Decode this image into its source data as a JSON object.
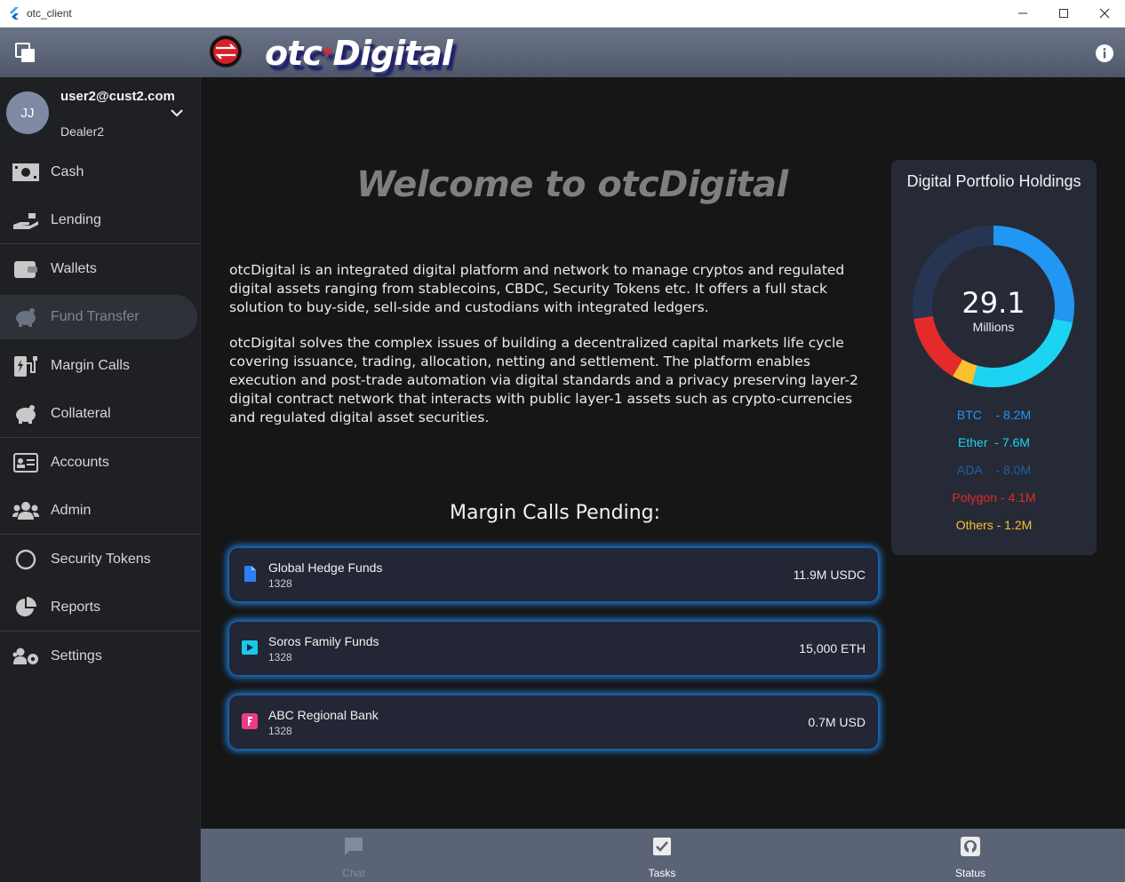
{
  "window": {
    "title": "otc_client"
  },
  "appbar": {
    "brand_left": "otc",
    "brand_star": "*",
    "brand_right": "Digital"
  },
  "user": {
    "initials": "JJ",
    "email": "user2@cust2.com",
    "role": "Dealer2"
  },
  "sidebar": {
    "items": [
      {
        "label": "Cash",
        "icon": "cash-icon"
      },
      {
        "label": "Lending",
        "icon": "hand-coin-icon"
      },
      {
        "label": "Wallets",
        "icon": "wallet-icon"
      },
      {
        "label": "Fund Transfer",
        "icon": "piggy-bank-icon",
        "active": true
      },
      {
        "label": "Margin Calls",
        "icon": "charging-station-icon"
      },
      {
        "label": "Collateral",
        "icon": "piggy-bank-icon"
      },
      {
        "label": "Accounts",
        "icon": "id-card-icon"
      },
      {
        "label": "Admin",
        "icon": "users-icon"
      },
      {
        "label": "Security Tokens",
        "icon": "circle-icon"
      },
      {
        "label": "Reports",
        "icon": "pie-chart-icon"
      },
      {
        "label": "Settings",
        "icon": "users-cog-icon"
      }
    ]
  },
  "main": {
    "welcome": "Welcome to otcDigital",
    "para1": "otcDigital is an integrated digital platform and network to manage cryptos and regulated digital assets ranging from stablecoins, CBDC, Security Tokens etc. It offers a full stack solution to buy-side, sell-side and custodians with integrated ledgers.",
    "para2": "otcDigital solves the complex issues of building a decentralized capital markets life cycle covering issuance, trading, allocation, netting and settlement. The platform enables execution and post-trade automation via digital standards and a privacy preserving layer-2 digital contract network that interacts with public layer-1 assets such as crypto-currencies and regulated digital asset securities.",
    "margin_title": "Margin Calls Pending:",
    "margin_calls": [
      {
        "name": "Global Hedge Funds",
        "id": "1328",
        "amount": "11.9M USDC",
        "icon": "document-icon",
        "icon_color": "#2f7ff0"
      },
      {
        "name": "Soros Family Funds",
        "id": "1328",
        "amount": "15,000 ETH",
        "icon": "play-icon",
        "icon_color": "#19c8e8"
      },
      {
        "name": "ABC Regional Bank",
        "id": "1328",
        "amount": "0.7M USD",
        "icon": "flash-doc-icon",
        "icon_color": "#ee3c86"
      }
    ]
  },
  "portfolio": {
    "title": "Digital Portfolio Holdings",
    "total": "29.1",
    "unit": "Millions",
    "legend": [
      {
        "text": "BTC    - 8.2M",
        "color": "#2196f3"
      },
      {
        "text": "Ether  - 7.6M",
        "color": "#1cd4f2"
      },
      {
        "text": "ADA    - 8.0M",
        "color": "#1f5fa0"
      },
      {
        "text": "Polygon - 4.1M",
        "color": "#e52a2a"
      },
      {
        "text": "Others - 1.2M",
        "color": "#fbc02d"
      }
    ],
    "slices": [
      {
        "name": "BTC",
        "value": 8.2,
        "color": "#2196f3"
      },
      {
        "name": "Ether",
        "value": 7.6,
        "color": "#1cd4f2"
      },
      {
        "name": "Others",
        "value": 1.2,
        "color": "#fbc02d"
      },
      {
        "name": "Polygon",
        "value": 4.1,
        "color": "#e52a2a"
      },
      {
        "name": "ADA",
        "value": 8.0,
        "color": "#263552"
      }
    ]
  },
  "bottombar": {
    "tabs": [
      {
        "label": "Chat",
        "icon": "chat-icon",
        "enabled": false
      },
      {
        "label": "Tasks",
        "icon": "checkbox-icon",
        "enabled": true
      },
      {
        "label": "Status",
        "icon": "github-icon",
        "enabled": true
      }
    ]
  }
}
